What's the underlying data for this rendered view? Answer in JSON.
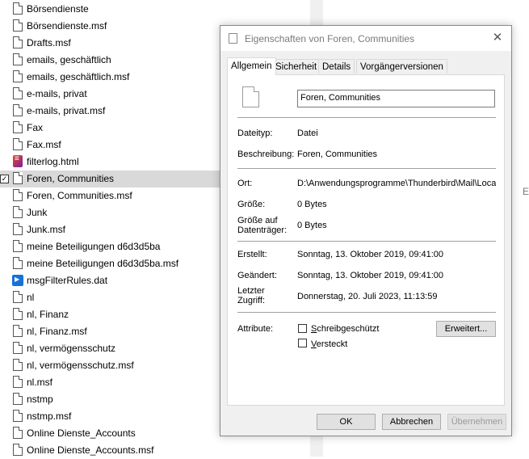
{
  "explorer": {
    "files": [
      {
        "name": "Börsendienste",
        "icon": "file-icon"
      },
      {
        "name": "Börsendienste.msf",
        "icon": "file-icon"
      },
      {
        "name": "Drafts.msf",
        "icon": "file-icon"
      },
      {
        "name": "emails, geschäftlich",
        "icon": "file-icon"
      },
      {
        "name": "emails, geschäftlich.msf",
        "icon": "file-icon"
      },
      {
        "name": "e-mails, privat",
        "icon": "file-icon"
      },
      {
        "name": "e-mails, privat.msf",
        "icon": "file-icon"
      },
      {
        "name": "Fax",
        "icon": "file-icon"
      },
      {
        "name": "Fax.msf",
        "icon": "file-icon"
      },
      {
        "name": "filterlog.html",
        "icon": "html-file-icon"
      },
      {
        "name": "Foren, Communities",
        "icon": "file-icon",
        "selected": true
      },
      {
        "name": "Foren, Communities.msf",
        "icon": "file-icon"
      },
      {
        "name": "Junk",
        "icon": "file-icon"
      },
      {
        "name": "Junk.msf",
        "icon": "file-icon"
      },
      {
        "name": "meine Beteiligungen d6d3d5ba",
        "icon": "file-icon"
      },
      {
        "name": "meine Beteiligungen d6d3d5ba.msf",
        "icon": "file-icon"
      },
      {
        "name": "msgFilterRules.dat",
        "icon": "app-file-icon"
      },
      {
        "name": "nl",
        "icon": "file-icon"
      },
      {
        "name": "nl, Finanz",
        "icon": "file-icon"
      },
      {
        "name": "nl, Finanz.msf",
        "icon": "file-icon"
      },
      {
        "name": "nl, vermögensschutz",
        "icon": "file-icon"
      },
      {
        "name": "nl, vermögensschutz.msf",
        "icon": "file-icon"
      },
      {
        "name": "nl.msf",
        "icon": "file-icon"
      },
      {
        "name": "nstmp",
        "icon": "file-icon"
      },
      {
        "name": "nstmp.msf",
        "icon": "file-icon"
      },
      {
        "name": "Online Dienste_Accounts",
        "icon": "file-icon"
      },
      {
        "name": "Online Dienste_Accounts.msf",
        "icon": "file-icon"
      }
    ],
    "checkmark": "✓"
  },
  "right_pane": {
    "cut_text": "Es"
  },
  "dialog": {
    "title": "Eigenschaften von Foren, Communities",
    "close_glyph": "✕",
    "tabs": [
      "Allgemein",
      "Sicherheit",
      "Details",
      "Vorgängerversionen"
    ],
    "active_tab": "Allgemein",
    "file_name": "Foren, Communities",
    "labels": {
      "dateityp": "Dateityp:",
      "beschreibung": "Beschreibung:",
      "ort": "Ort:",
      "groesse": "Größe:",
      "groesse_dt_1": "Größe auf",
      "groesse_dt_2": "Datenträger:",
      "erstellt": "Erstellt:",
      "geaendert": "Geändert:",
      "zugriff_1": "Letzter",
      "zugriff_2": "Zugriff:",
      "attribute": "Attribute:"
    },
    "values": {
      "dateityp": "Datei",
      "beschreibung": "Foren, Communities",
      "ort": "D:\\Anwendungsprogramme\\Thunderbird\\Mail\\Local",
      "groesse": "0 Bytes",
      "groesse_dt": "0 Bytes",
      "erstellt": "Sonntag, 13. Oktober 2019, 09:41:00",
      "geaendert": "Sonntag, 13. Oktober 2019, 09:41:00",
      "zugriff": "Donnerstag, 20. Juli 2023, 11:13:59"
    },
    "attributes": {
      "schreibgeschuetzt": {
        "accel": "S",
        "rest": "chreibgeschützt",
        "checked": false
      },
      "versteckt": {
        "accel": "V",
        "rest": "ersteckt",
        "checked": false
      }
    },
    "erweitert_label": "Erweitert...",
    "buttons": {
      "ok": "OK",
      "abbrechen": "Abbrechen",
      "uebernehmen": "Übernehmen"
    }
  }
}
